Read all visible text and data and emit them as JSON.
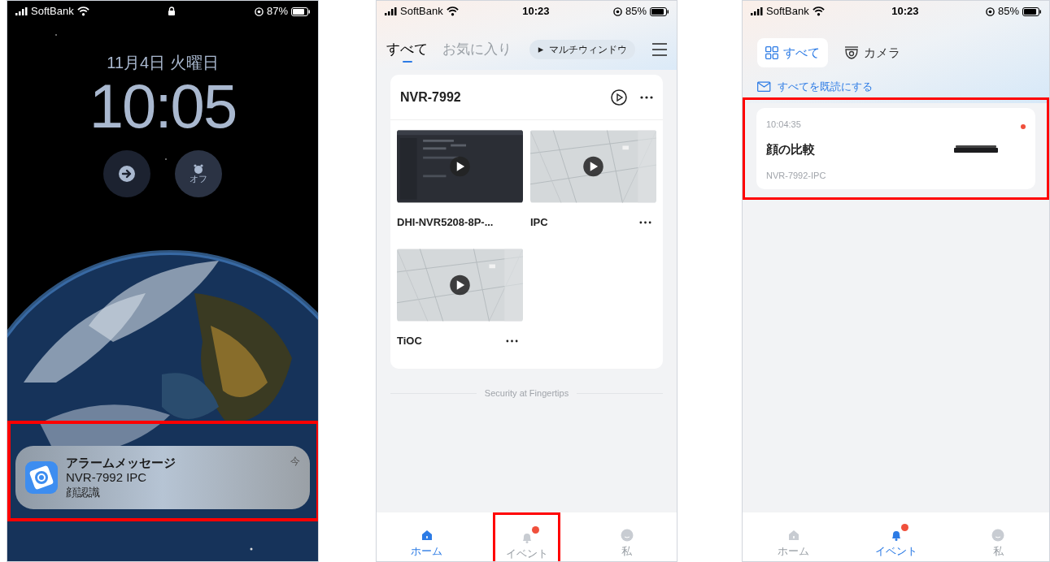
{
  "lock_screen": {
    "status_bar": {
      "carrier": "SoftBank",
      "battery": "87%"
    },
    "date": "11月4日 火曜日",
    "time": "10:05",
    "alarm_label": "オフ",
    "notification": {
      "title": "アラームメッセージ",
      "time": "今",
      "line_1": "NVR-7992 IPC",
      "line_2": "顔認識",
      "highlighted": true
    }
  },
  "home_screen": {
    "status_bar": {
      "carrier": "SoftBank",
      "time": "10:23",
      "battery": "85%"
    },
    "tabs": [
      {
        "label": "すべて",
        "selected": true
      },
      {
        "label": "お気に入り",
        "selected": false
      }
    ],
    "multi_window_button": "マルチウィンドウ",
    "device": {
      "name": "NVR-7992",
      "channels": [
        {
          "name": "DHI-NVR5208-8P-...",
          "kind": "screen",
          "more_button": false
        },
        {
          "name": "IPC",
          "kind": "ceiling",
          "more_button": true
        },
        {
          "name": "TiOC",
          "kind": "ceiling",
          "more_button": true
        }
      ]
    },
    "footer": "Security at Fingertips",
    "bottom_nav": [
      {
        "label": "ホーム",
        "kind": "home",
        "selected": true,
        "badge": false,
        "highlighted": false
      },
      {
        "label": "イベント",
        "kind": "bell",
        "selected": false,
        "badge": true,
        "highlighted": true
      },
      {
        "label": "私",
        "kind": "face",
        "selected": false,
        "badge": false,
        "highlighted": false
      }
    ]
  },
  "events_screen": {
    "status_bar": {
      "carrier": "SoftBank",
      "time": "10:23",
      "battery": "85%"
    },
    "tabs": [
      {
        "label": "すべて",
        "kind": "grid",
        "selected": true
      },
      {
        "label": "カメラ",
        "kind": "camera",
        "selected": false
      }
    ],
    "mark_all_read": "すべてを既読にする",
    "events": [
      {
        "time": "10:04:35",
        "title": "顔の比較",
        "device": "NVR-7992-IPC",
        "unread": true,
        "highlighted": true
      }
    ],
    "bottom_nav": [
      {
        "label": "ホーム",
        "kind": "home",
        "selected": false,
        "badge": false
      },
      {
        "label": "イベント",
        "kind": "bell",
        "selected": true,
        "badge": true
      },
      {
        "label": "私",
        "kind": "face",
        "selected": false,
        "badge": false
      }
    ]
  }
}
